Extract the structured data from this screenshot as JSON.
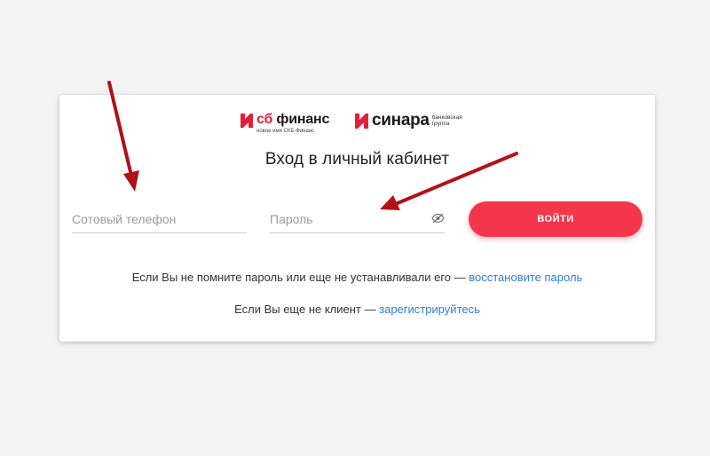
{
  "logos": {
    "sb": {
      "prefix": "сб",
      "name": "финанс",
      "tagline": "новое имя СКБ-Финанс"
    },
    "sinara": {
      "name": "синара",
      "tagline": "банковская группа"
    }
  },
  "title": "Вход в личный кабинет",
  "form": {
    "phone_placeholder": "Сотовый телефон",
    "phone_value": "",
    "password_placeholder": "Пароль",
    "password_value": "",
    "login_label": "ВОЙТИ"
  },
  "help": {
    "recover_text": "Если Вы не помните пароль или еще не устанавливали его — ",
    "recover_link": "восстановите пароль",
    "register_text": "Если Вы еще не клиент — ",
    "register_link": "зарегистрируйтесь"
  },
  "colors": {
    "accent": "#f4364c",
    "brand_red": "#e31e3c",
    "link": "#2d7fd6",
    "annotation_arrow": "#b01217"
  }
}
